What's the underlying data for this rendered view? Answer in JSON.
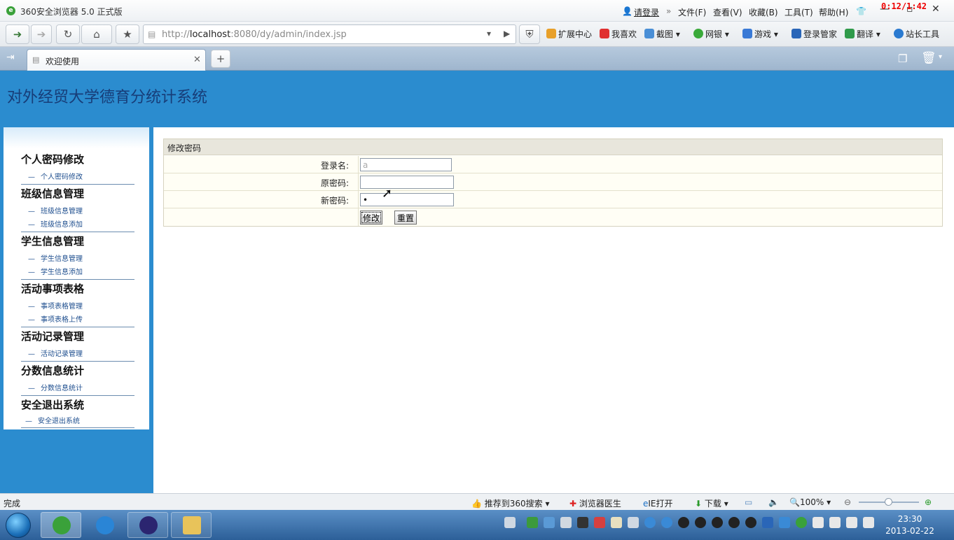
{
  "window": {
    "title": "360安全浏览器 5.0 正式版",
    "login": "请登录",
    "menus": [
      "文件(F)",
      "查看(V)",
      "收藏(B)",
      "工具(T)",
      "帮助(H)"
    ],
    "clock": "0:12/1:42"
  },
  "toolbar": {
    "url_host": "http://",
    "url_main": "localhost",
    "url_rest": ":8080/dy/admin/index.jsp",
    "items": [
      "扩展中心",
      "我喜欢",
      "截图",
      "网银",
      "游戏",
      "登录管家",
      "翻译",
      "站长工具"
    ]
  },
  "tab": {
    "label": "欢迎使用"
  },
  "site": {
    "title": "对外经贸大学德育分统计系统"
  },
  "sidebar": [
    {
      "title": "个人密码修改",
      "links": [
        "个人密码修改"
      ]
    },
    {
      "title": "班级信息管理",
      "links": [
        "班级信息管理",
        "班级信息添加"
      ]
    },
    {
      "title": "学生信息管理",
      "links": [
        "学生信息管理",
        "学生信息添加"
      ]
    },
    {
      "title": "活动事项表格",
      "links": [
        "事项表格管理",
        "事项表格上传"
      ]
    },
    {
      "title": "活动记录管理",
      "links": [
        "活动记录管理"
      ]
    },
    {
      "title": "分数信息统计",
      "links": [
        "分数信息统计"
      ]
    },
    {
      "title": "安全退出系统",
      "links": [
        "安全退出系统"
      ]
    }
  ],
  "form": {
    "header": "修改密码",
    "login_label": "登录名:",
    "login_value": "a",
    "old_label": "原密码:",
    "old_value": "",
    "new_label": "新密码:",
    "new_value": "•",
    "submit": "修改",
    "reset": "重置"
  },
  "status": {
    "left": "完成",
    "search": "推荐到360搜索",
    "doctor": "浏览器医生",
    "ie": "IE打开",
    "download": "下载",
    "zoom": "100%"
  },
  "taskbar": {
    "time": "23:30",
    "date": "2013-02-22"
  },
  "colors": {
    "page_bg": "#2b8ccf",
    "title_text": "#173d78"
  }
}
